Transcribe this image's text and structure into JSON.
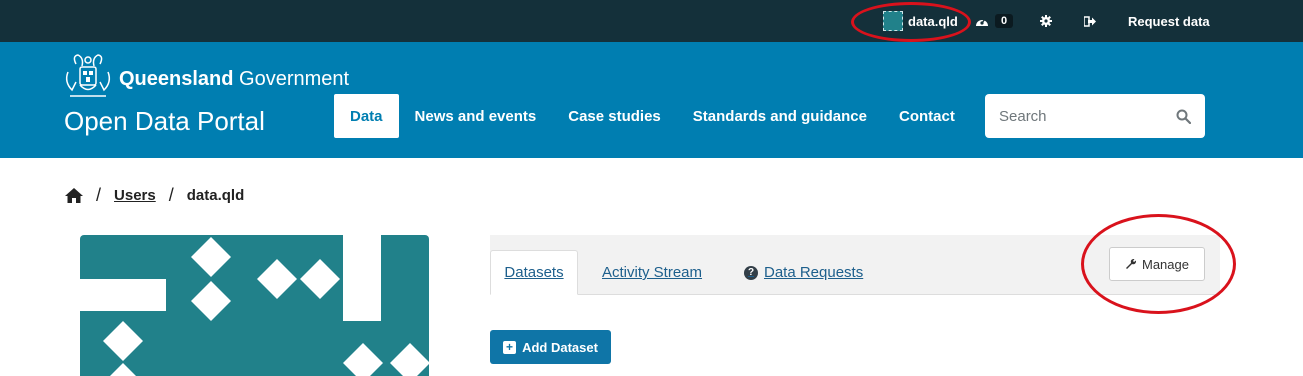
{
  "topbar": {
    "user_label": "data.qld",
    "dashboard_count": "0",
    "request_label": "Request data"
  },
  "brand": {
    "gov_bold": "Queensland",
    "gov_rest": " Government",
    "portal_title": "Open Data Portal"
  },
  "nav": {
    "items": [
      {
        "label": "Data"
      },
      {
        "label": "News and events"
      },
      {
        "label": "Case studies"
      },
      {
        "label": "Standards and guidance"
      },
      {
        "label": "Contact"
      }
    ]
  },
  "search": {
    "placeholder": "Search"
  },
  "breadcrumb": {
    "users": "Users",
    "current": "data.qld",
    "separator": "/"
  },
  "tabs": [
    {
      "label": "Datasets"
    },
    {
      "label": "Activity Stream"
    },
    {
      "label": "Data Requests"
    }
  ],
  "actions": {
    "manage": "Manage",
    "add_dataset": "Add Dataset"
  },
  "colors": {
    "topbar": "#14303a",
    "masthead": "#007eb1",
    "avatar_teal": "#21818a",
    "annotation_red": "#d9121c"
  }
}
